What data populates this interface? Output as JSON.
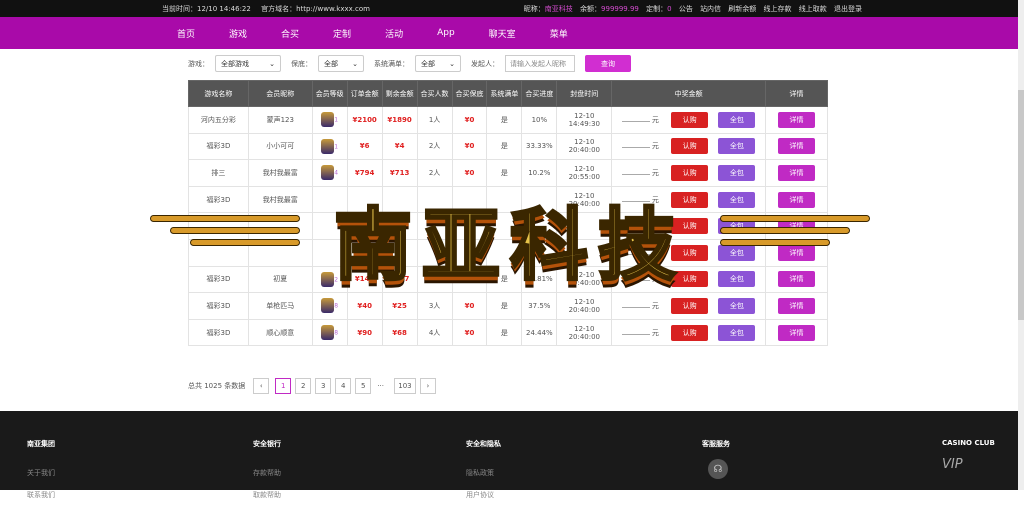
{
  "topbar": {
    "time_label": "当前时间：12/10 14:46:22",
    "domain_label": "官方域名：http://www.kxxx.com",
    "nick_label": "昵称：",
    "nick_value": "南亚科技",
    "balance_label": "余额：",
    "balance_value": "999999.99",
    "custom_label": "定制：",
    "custom_value": "0",
    "links": [
      "公告",
      "站内信",
      "刷新余额",
      "线上存款",
      "线上取款",
      "退出登录"
    ]
  },
  "nav": [
    "首页",
    "游戏",
    "合买",
    "定制",
    "活动",
    "App",
    "聊天室",
    "菜单"
  ],
  "filter": {
    "game_label": "游戏：",
    "game_value": "全部游戏",
    "guarantee_label": "保底：",
    "guarantee_value": "全部",
    "full_label": "系统满单：",
    "full_value": "全部",
    "initiator_label": "发起人：",
    "initiator_placeholder": "请输入发起人昵称",
    "search_label": "查询"
  },
  "table": {
    "headers": [
      "游戏名称",
      "会员昵称",
      "会员等级",
      "订单金额",
      "剩余金额",
      "合买人数",
      "合买保底",
      "系统满单",
      "合买进度",
      "封盘时间",
      "中奖金额",
      "详情"
    ],
    "rows": [
      [
        "河内五分彩",
        "蒙声123",
        "1",
        "¥2100",
        "¥1890",
        "1人",
        "¥0",
        "是",
        "10%",
        "12-10 14:49:30"
      ],
      [
        "福彩3D",
        "小小可可",
        "1",
        "¥6",
        "¥4",
        "2人",
        "¥0",
        "是",
        "33.33%",
        "12-10 20:40:00"
      ],
      [
        "排三",
        "我村我最富",
        "4",
        "¥794",
        "¥713",
        "2人",
        "¥0",
        "是",
        "10.2%",
        "12-10 20:55:00"
      ],
      [
        "福彩3D",
        "我村我最富",
        "",
        "",
        "",
        "",
        "",
        "",
        "",
        "12-10 20:40:00"
      ],
      [
        "",
        "",
        "",
        "",
        "",
        "",
        "",
        "",
        "",
        ""
      ],
      [
        "",
        "",
        "",
        "",
        "",
        "",
        "",
        "",
        "",
        ""
      ],
      [
        "福彩3D",
        "初夏",
        "2",
        "¥144",
        "¥127",
        "3人",
        "¥0",
        "是",
        "11.81%",
        "12-10 20:40:00"
      ],
      [
        "福彩3D",
        "单枪匹马",
        "8",
        "¥40",
        "¥25",
        "3人",
        "¥0",
        "是",
        "37.5%",
        "12-10 20:40:00"
      ],
      [
        "福彩3D",
        "顺心顺意",
        "8",
        "¥90",
        "¥68",
        "4人",
        "¥0",
        "是",
        "24.44%",
        "12-10 20:40:00"
      ]
    ],
    "unit": "元",
    "btn_buy": "认购",
    "btn_all": "全包",
    "btn_detail": "详情"
  },
  "pager": {
    "total": "总共 1025 条数据",
    "pages": [
      "1",
      "2",
      "3",
      "4",
      "5"
    ],
    "dots": "···",
    "last": "103",
    "prev": "‹",
    "next": "›"
  },
  "overlay": {
    "title": "南亚科技"
  },
  "footer": {
    "cols": [
      {
        "h": "南亚集团",
        "items": [
          "关于我们",
          "联系我们"
        ]
      },
      {
        "h": "安全银行",
        "items": [
          "存款帮助",
          "取款帮助"
        ]
      },
      {
        "h": "安全和隐私",
        "items": [
          "隐私政策",
          "用户协议"
        ]
      },
      {
        "h": "客服服务",
        "items": []
      },
      {
        "h": "CASINO CLUB",
        "items": []
      }
    ],
    "vip": "VIP"
  }
}
